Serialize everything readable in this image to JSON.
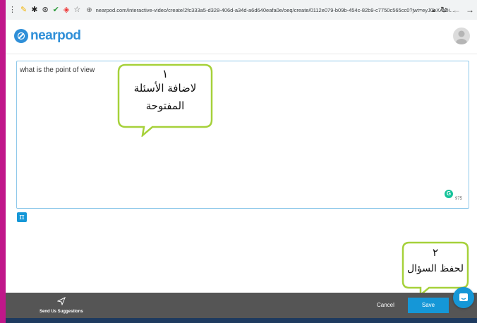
{
  "browser": {
    "url": "nearpod.com/interactive-video/create/2fc333a5-d328-406d-a34d-a6d640eafa0e/oeq/create/0112e079-b09b-454c-82b9-c7750c565cc0?jwt=eyJ0eXAiOi..."
  },
  "header": {
    "logo_text": "nearpod"
  },
  "editor": {
    "text": "what is the point of view",
    "char_count": "975",
    "grammarly_label": "G",
    "math_button_label": "π"
  },
  "callouts": [
    {
      "number": "١",
      "line1": "لاضافة الأسئلة",
      "line2": "المفتوحة"
    },
    {
      "number": "٢",
      "line1": "لحفظ السؤال",
      "line2": ""
    }
  ],
  "footer": {
    "suggestions_label": "Send Us Suggestions",
    "cancel_label": "Cancel",
    "save_label": "Save"
  },
  "colors": {
    "accent": "#1597d7",
    "callout_border": "#a6d13a",
    "page_border": "#c0178a",
    "footer_bg": "#555555"
  }
}
